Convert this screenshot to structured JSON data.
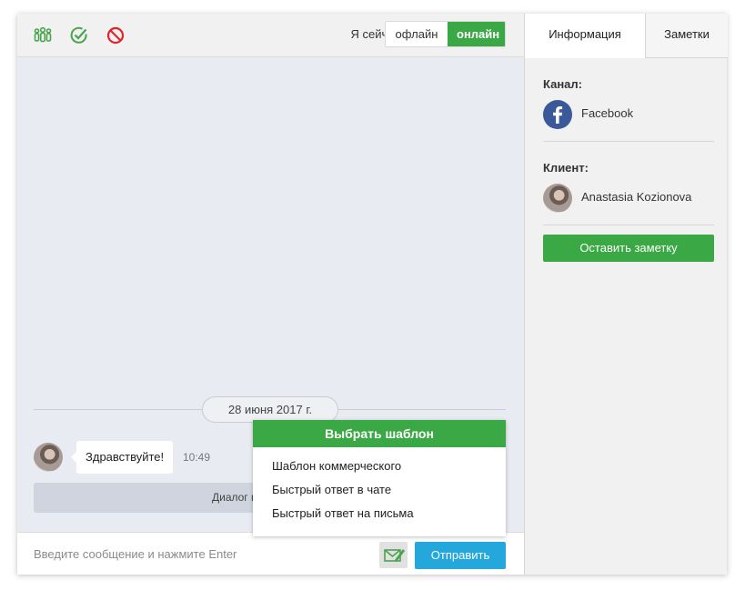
{
  "toolbar": {
    "icons": [
      "group-icon",
      "check-circle-icon",
      "block-icon"
    ],
    "status_label": "Я сейчас",
    "offline_label": "офлайн",
    "online_label": "онлайн"
  },
  "messages": {
    "date": "28 июня 2017 г.",
    "items": [
      {
        "text": "Здравствуйте!",
        "time": "10:49"
      }
    ],
    "system_text": "Диалог начинает агент"
  },
  "template_menu": {
    "title": "Выбрать шаблон",
    "items": [
      "Шаблон коммерческого",
      "Быстрый ответ в чате",
      "Быстрый ответ на письма"
    ]
  },
  "composer": {
    "placeholder": "Введите сообщение и нажмите Enter",
    "value": "",
    "send_label": "Отправить"
  },
  "side": {
    "tabs": [
      "Информация",
      "Заметки"
    ],
    "channel_label": "Канал:",
    "channel_name": "Facebook",
    "client_label": "Клиент:",
    "client_name": "Anastasia Kozionova",
    "note_button": "Оставить заметку"
  },
  "colors": {
    "green": "#3aa845",
    "blue": "#24a7db",
    "red": "#e0232e",
    "facebook": "#3b5998"
  }
}
